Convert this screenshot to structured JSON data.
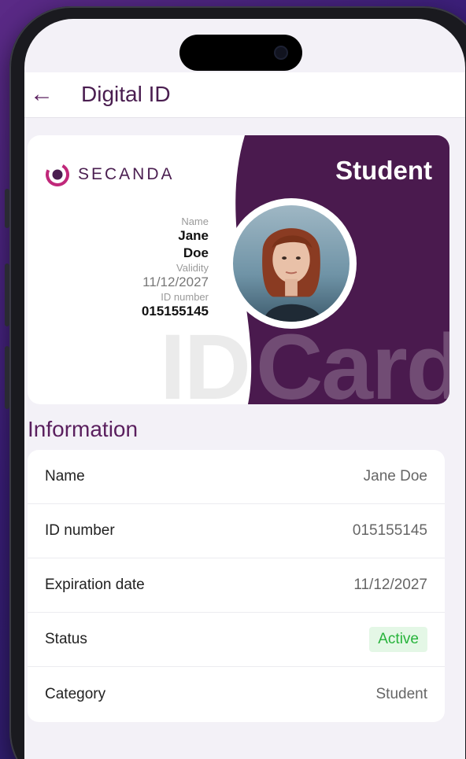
{
  "appbar": {
    "title": "Digital ID"
  },
  "card": {
    "brand": "SECANDA",
    "role": "Student",
    "name_label": "Name",
    "first_name": "Jane",
    "last_name": "Doe",
    "validity_label": "Validity",
    "validity": "11/12/2027",
    "id_label": "ID number",
    "id_number": "015155145",
    "watermark_left": "ID",
    "watermark_right": "Card"
  },
  "info": {
    "title": "Information",
    "rows": [
      {
        "label": "Name",
        "value": "Jane Doe"
      },
      {
        "label": "ID number",
        "value": "015155145"
      },
      {
        "label": "Expiration date",
        "value": "11/12/2027"
      },
      {
        "label": "Status",
        "value": "Active"
      },
      {
        "label": "Category",
        "value": "Student"
      }
    ]
  },
  "colors": {
    "brand_purple": "#4a1a4e",
    "active_green": "#27b33b"
  }
}
